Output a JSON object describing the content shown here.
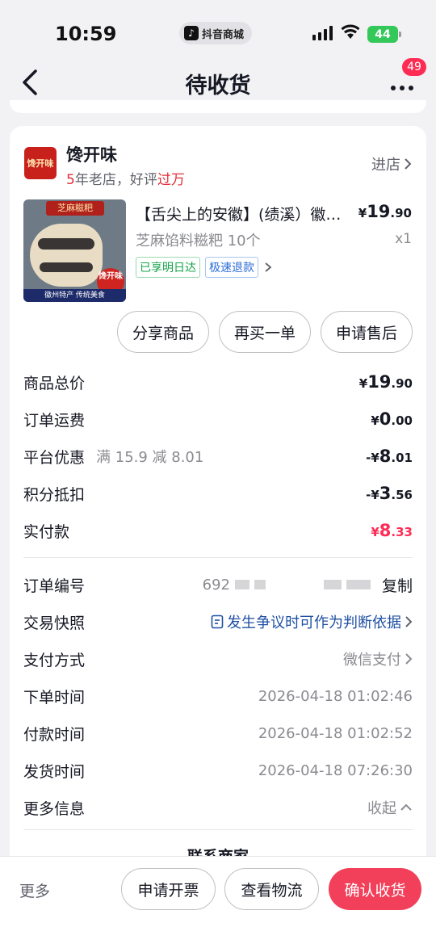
{
  "status_bar": {
    "time": "10:59",
    "app_pill": "抖音商城",
    "battery": "44"
  },
  "nav": {
    "title": "待收货",
    "badge": "49"
  },
  "shop": {
    "logo_text": "馋开味",
    "name": "馋开味",
    "years": "5",
    "years_suffix": "年老店，好评",
    "reviews": "过万",
    "enter_label": "进店"
  },
  "product": {
    "image_title": "芝麻糍粑",
    "image_stamp": "馋开味",
    "image_bottom": "徽州特产 传统美食",
    "title": "【舌尖上的安徽】(绩溪）徽…",
    "price_symbol": "¥",
    "price_int": "19",
    "price_dec": ".90",
    "spec": "芝麻馅料糍粑 10个",
    "qty": "x1",
    "tags": [
      "已享明日达",
      "极速退款"
    ]
  },
  "product_actions": [
    "分享商品",
    "再买一单",
    "申请售后"
  ],
  "summary": [
    {
      "label": "商品总价",
      "prefix": "¥",
      "int": "19",
      "dec": ".90",
      "note": ""
    },
    {
      "label": "订单运费",
      "prefix": "¥",
      "int": "0",
      "dec": ".00",
      "note": ""
    },
    {
      "label": "平台优惠",
      "prefix": "-¥",
      "int": "8",
      "dec": ".01",
      "note": "满 15.9 减 8.01"
    },
    {
      "label": "积分抵扣",
      "prefix": "-¥",
      "int": "3",
      "dec": ".56",
      "note": ""
    },
    {
      "label": "实付款",
      "prefix": "¥",
      "int": "8",
      "dec": ".33",
      "note": ""
    }
  ],
  "order_info": {
    "order_no_label": "订单编号",
    "order_no_prefix": "692",
    "copy_label": "复制",
    "snapshot_label": "交易快照",
    "snapshot_link": "发生争议时可作为判断依据",
    "pay_label": "支付方式",
    "pay_value": "微信支付",
    "order_time_label": "下单时间",
    "order_time": "2026-04-18 01:02:46",
    "pay_time_label": "付款时间",
    "pay_time": "2026-04-18 01:02:52",
    "ship_time_label": "发货时间",
    "ship_time": "2026-04-18 07:26:30",
    "more_label": "更多信息",
    "collapse_label": "收起"
  },
  "contact_label": "联系商家",
  "bottom_bar": {
    "more": "更多",
    "invoice": "申请开票",
    "logistics": "查看物流",
    "confirm": "确认收货"
  },
  "colors": {
    "accent": "#fe2c55",
    "link": "#1f4fa3",
    "confirm": "#f2405a"
  }
}
